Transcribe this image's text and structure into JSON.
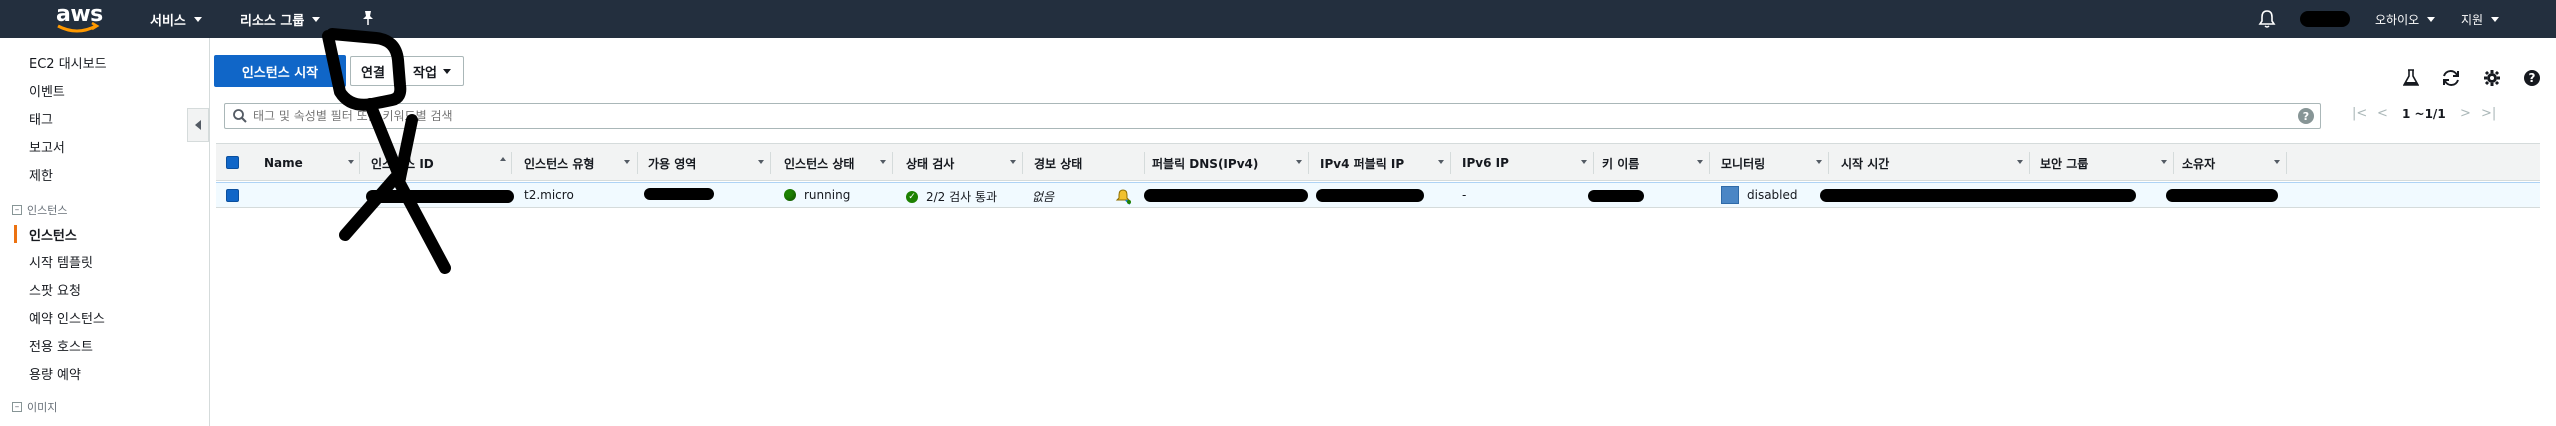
{
  "nav": {
    "logo": "aws",
    "services": "서비스",
    "resource_groups": "리소스 그룹",
    "region": "오하이오",
    "support": "지원"
  },
  "sidebar": {
    "items_top": [
      "EC2 대시보드",
      "이벤트",
      "태그",
      "보고서",
      "제한"
    ],
    "section_instances": "인스턴스",
    "items_instances": [
      "인스턴스",
      "시작 템플릿",
      "스팟 요청",
      "예약 인스턴스",
      "전용 호스트",
      "용량 예약"
    ],
    "section_images": "이미지"
  },
  "toolbar": {
    "launch": "인스턴스 시작",
    "connect": "연결",
    "actions": "작업"
  },
  "search": {
    "placeholder": "태그 및 속성별 필터 또는 키워드별 검색"
  },
  "pager": {
    "range": "1 ~1/1"
  },
  "table": {
    "columns": [
      "Name",
      "인스턴스 ID",
      "인스턴스 유형",
      "가용 영역",
      "인스턴스 상태",
      "상태 검사",
      "경보 상태",
      "퍼블릭 DNS(IPv4)",
      "IPv4 퍼블릭 IP",
      "IPv6 IP",
      "키 이름",
      "모니터링",
      "시작 시간",
      "보안 그룹",
      "소유자"
    ],
    "row": {
      "type": "t2.micro",
      "state": "running",
      "status_check": "2/2 검사 통과",
      "alarm": "없음",
      "ipv6": "-",
      "monitoring": "disabled"
    }
  },
  "colors": {
    "nav_bg": "#232f3e",
    "primary": "#1066c8",
    "running": "#1d8102",
    "active_accent": "#ec7211"
  }
}
